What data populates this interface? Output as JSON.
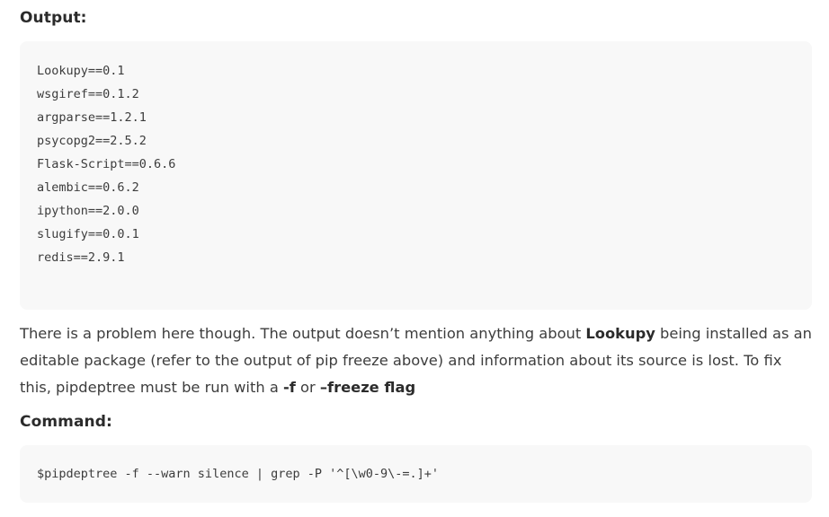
{
  "output_section": {
    "heading": "Output:",
    "lines": [
      "Lookupy==0.1",
      "wsgiref==0.1.2",
      "argparse==1.2.1",
      "psycopg2==2.5.2",
      "Flask-Script==0.6.6",
      "alembic==0.6.2",
      "ipython==2.0.0",
      "slugify==0.0.1",
      "redis==2.9.1"
    ]
  },
  "paragraph": {
    "part1": "There is a problem here though. The output doesn’t mention anything about ",
    "bold1": "Lookupy",
    "part2": " being installed as an editable package (refer to the output of pip freeze above) and information about its source is lost. To fix this, pipdeptree must be run with a ",
    "bold2": "-f",
    "part3": " or ",
    "bold3": "–freeze flag"
  },
  "command_section": {
    "heading": "Command:",
    "command": "$pipdeptree -f --warn silence | grep -P '^[\\w0-9\\-=.]+'"
  }
}
